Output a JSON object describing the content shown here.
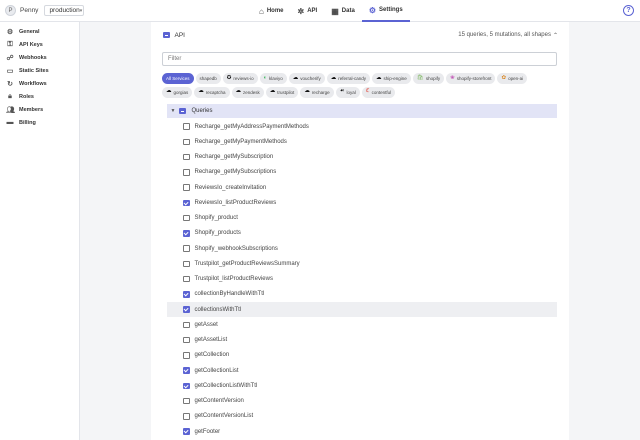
{
  "header": {
    "avatar_letter": "P",
    "app_name": "Penny",
    "environment": "production",
    "tabs": [
      {
        "label": "Home",
        "icon": "home-icon"
      },
      {
        "label": "API",
        "icon": "api-icon"
      },
      {
        "label": "Data",
        "icon": "data-icon"
      },
      {
        "label": "Settings",
        "icon": "gear-icon",
        "active": true
      }
    ],
    "help_icon": "help-icon"
  },
  "sidebar": {
    "items": [
      {
        "label": "General",
        "icon": "gear-icon"
      },
      {
        "label": "API Keys",
        "icon": "key-icon"
      },
      {
        "label": "Webhooks",
        "icon": "webhook-icon"
      },
      {
        "label": "Static Sites",
        "icon": "site-icon"
      },
      {
        "label": "Workflows",
        "icon": "workflow-icon"
      },
      {
        "label": "Roles",
        "icon": "lock-icon"
      },
      {
        "label": "Members",
        "icon": "members-icon"
      },
      {
        "label": "Billing",
        "icon": "card-icon"
      }
    ]
  },
  "api": {
    "title": "API",
    "summary": "15 queries, 5 mutations, all shapes",
    "filter_placeholder": "Filter",
    "services": [
      {
        "label": "All Services",
        "active": true,
        "icon": ""
      },
      {
        "label": "shapedb",
        "icon": ""
      },
      {
        "label": "reviews-io",
        "icon": "reviews-io-icon"
      },
      {
        "label": "klaviyo",
        "icon": "klaviyo-icon"
      },
      {
        "label": "voucherify",
        "icon": "cloud-icon"
      },
      {
        "label": "referral-candy",
        "icon": "cloud-icon"
      },
      {
        "label": "ship-engine",
        "icon": "cloud-icon"
      },
      {
        "label": "shopify",
        "icon": "shopify-icon"
      },
      {
        "label": "shopify-storefront",
        "icon": "shopify-storefront-icon"
      },
      {
        "label": "open-ai",
        "icon": "openai-icon"
      },
      {
        "label": "gorgias",
        "icon": "cloud-icon"
      },
      {
        "label": "recaptcha",
        "icon": "cloud-icon"
      },
      {
        "label": "zendesk",
        "icon": "cloud-icon"
      },
      {
        "label": "trustpilot",
        "icon": "cloud-icon"
      },
      {
        "label": "recharge",
        "icon": "cloud-icon"
      },
      {
        "label": "loyal",
        "icon": "loyal-icon"
      },
      {
        "label": "contentful",
        "icon": "contentful-icon"
      }
    ],
    "queries_label": "Queries",
    "queries": [
      {
        "name": "Recharge_getMyAddressPaymentMethods",
        "checked": false
      },
      {
        "name": "Recharge_getMyPaymentMethods",
        "checked": false
      },
      {
        "name": "Recharge_getMySubscription",
        "checked": false
      },
      {
        "name": "Recharge_getMySubscriptions",
        "checked": false
      },
      {
        "name": "ReviewsIo_createInvitation",
        "checked": false
      },
      {
        "name": "ReviewsIo_listProductReviews",
        "checked": true
      },
      {
        "name": "Shopify_product",
        "checked": false
      },
      {
        "name": "Shopify_products",
        "checked": true
      },
      {
        "name": "Shopify_webhookSubscriptions",
        "checked": false
      },
      {
        "name": "Trustpilot_getProductReviewsSummary",
        "checked": false
      },
      {
        "name": "Trustpilot_listProductReviews",
        "checked": false
      },
      {
        "name": "collectionByHandleWithTtl",
        "checked": true
      },
      {
        "name": "collectionsWithTtl",
        "checked": true,
        "highlight": true
      },
      {
        "name": "getAsset",
        "checked": false
      },
      {
        "name": "getAssetList",
        "checked": false
      },
      {
        "name": "getCollection",
        "checked": false
      },
      {
        "name": "getCollectionList",
        "checked": true
      },
      {
        "name": "getCollectionListWithTtl",
        "checked": true
      },
      {
        "name": "getContentVersion",
        "checked": false
      },
      {
        "name": "getContentVersionList",
        "checked": false
      },
      {
        "name": "getFooter",
        "checked": true
      }
    ]
  }
}
